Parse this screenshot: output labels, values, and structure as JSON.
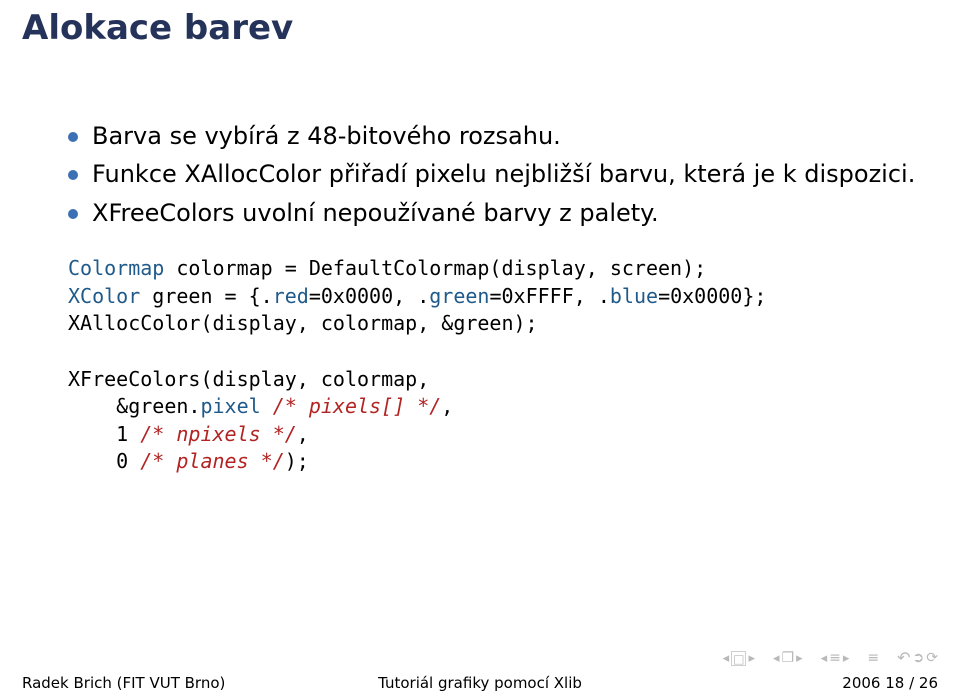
{
  "title": "Alokace barev",
  "bullets": [
    "Barva se vybírá z 48-bitového rozsahu.",
    "Funkce XAllocColor přiřadí pixelu nejbližší barvu, která je k dispozici.",
    "XFreeColors uvolní nepoužívané barvy z palety."
  ],
  "code": {
    "l1_a": "Colormap",
    "l1_b": " colormap = DefaultColormap(display, screen);",
    "l2_a": "XColor",
    "l2_b": " green = {.",
    "l2_c": "red",
    "l2_d": "=0x0000, .",
    "l2_e": "green",
    "l2_f": "=0xFFFF, .",
    "l2_g": "blue",
    "l2_h": "=0x0000};",
    "l3": "XAllocColor(display, colormap, &green);",
    "blank": "",
    "l4": "XFreeColors(display, colormap,",
    "l5_a": "    &green.",
    "l5_b": "pixel",
    "l5_c": " ",
    "l5_d": "/* pixels[] */",
    "l5_e": ",",
    "l6_a": "    1 ",
    "l6_b": "/* npixels */",
    "l6_c": ",",
    "l7_a": "    0 ",
    "l7_b": "/* planes */",
    "l7_c": ");"
  },
  "footer": {
    "left": "Radek Brich (FIT VUT Brno)",
    "center": "Tutoriál grafiky pomocí Xlib",
    "right": "2006      18 / 26"
  },
  "nav": {
    "tri_l": "◂",
    "tri_r": "▸",
    "box": "□",
    "frame": "❐",
    "lines": "≡",
    "undo": "↶",
    "loop1": "➲",
    "loop2": "⟳"
  }
}
